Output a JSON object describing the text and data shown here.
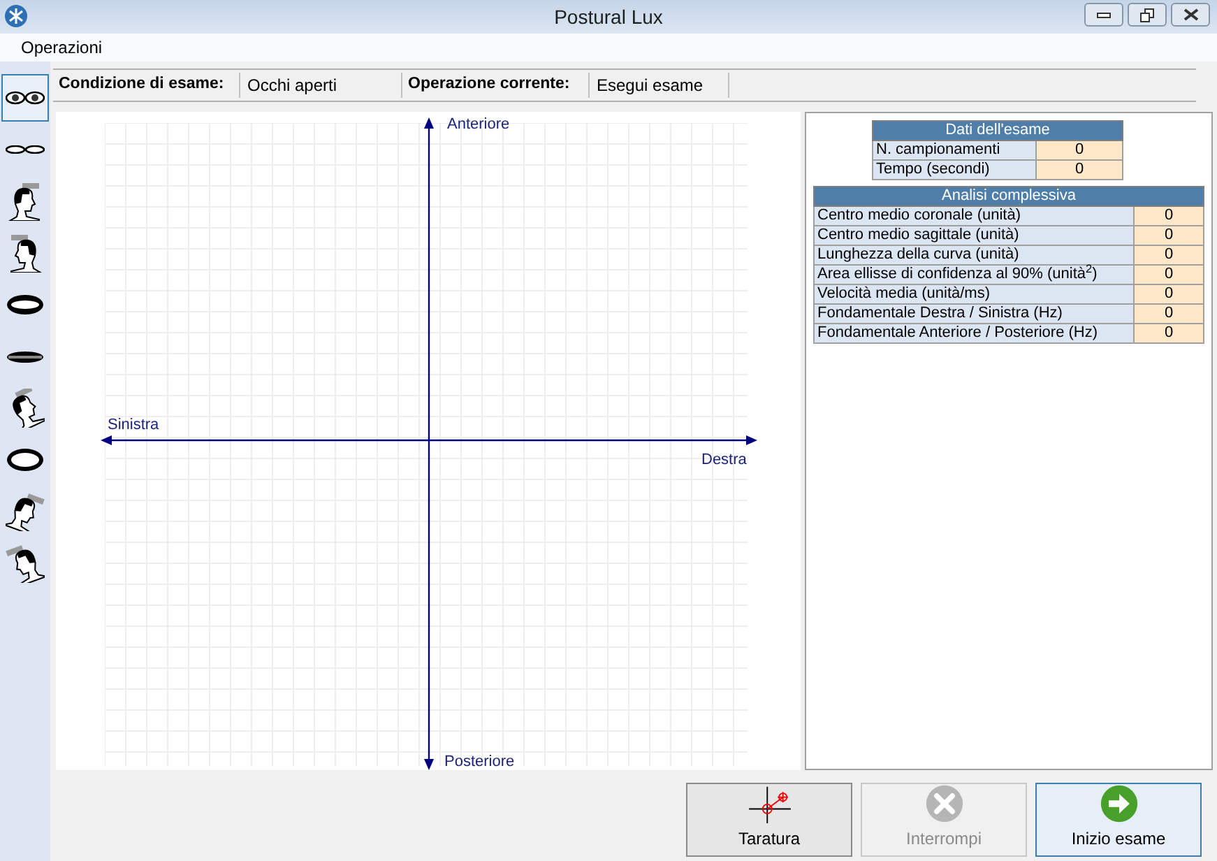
{
  "window": {
    "title": "Postural Lux"
  },
  "menu": [
    "Operazioni"
  ],
  "sidebar": {
    "items": [
      {
        "kind": "eyes_open",
        "selected": true
      },
      {
        "kind": "eyes_closed",
        "selected": false
      },
      {
        "kind": "head_right",
        "selected": false
      },
      {
        "kind": "head_left",
        "selected": false
      },
      {
        "kind": "mouth_open",
        "selected": false
      },
      {
        "kind": "mouth_closed",
        "selected": false
      },
      {
        "kind": "head_back",
        "selected": false
      },
      {
        "kind": "mouth_wide",
        "selected": false
      },
      {
        "kind": "head_tilt_right",
        "selected": false
      },
      {
        "kind": "head_tilt_left",
        "selected": false
      }
    ]
  },
  "status": {
    "condition_label": "Condizione di esame:",
    "condition_value": "Occhi aperti",
    "operation_label": "Operazione corrente:",
    "operation_value": "Esegui esame"
  },
  "plot": {
    "top": "Anteriore",
    "bottom": "Posteriore",
    "left": "Sinistra",
    "right": "Destra"
  },
  "exam_data": {
    "title": "Dati dell'esame",
    "rows": [
      {
        "label": "N. campionamenti",
        "value": "0"
      },
      {
        "label": "Tempo (secondi)",
        "value": "0"
      }
    ]
  },
  "analysis": {
    "title": "Analisi complessiva",
    "rows": [
      {
        "label": "Centro medio coronale (unità)",
        "value": "0"
      },
      {
        "label": "Centro medio sagittale (unità)",
        "value": "0"
      },
      {
        "label": "Lunghezza della curva (unità)",
        "value": "0"
      },
      {
        "label": "Area ellisse di confidenza al 90% (unità$^{2}$)",
        "value": "0"
      },
      {
        "label": "Velocità media (unità/ms)",
        "value": "0"
      },
      {
        "label": "Fondamentale Destra / Sinistra (Hz)",
        "value": "0"
      },
      {
        "label": "Fondamentale Anteriore / Posteriore (Hz)",
        "value": "0"
      }
    ]
  },
  "buttons": [
    {
      "kind": "calibrate",
      "label": "Taratura",
      "disabled": false,
      "focused": false
    },
    {
      "kind": "stop",
      "label": "Interrompi",
      "disabled": true,
      "focused": false
    },
    {
      "kind": "start",
      "label": "Inizio esame",
      "disabled": false,
      "focused": true
    }
  ]
}
